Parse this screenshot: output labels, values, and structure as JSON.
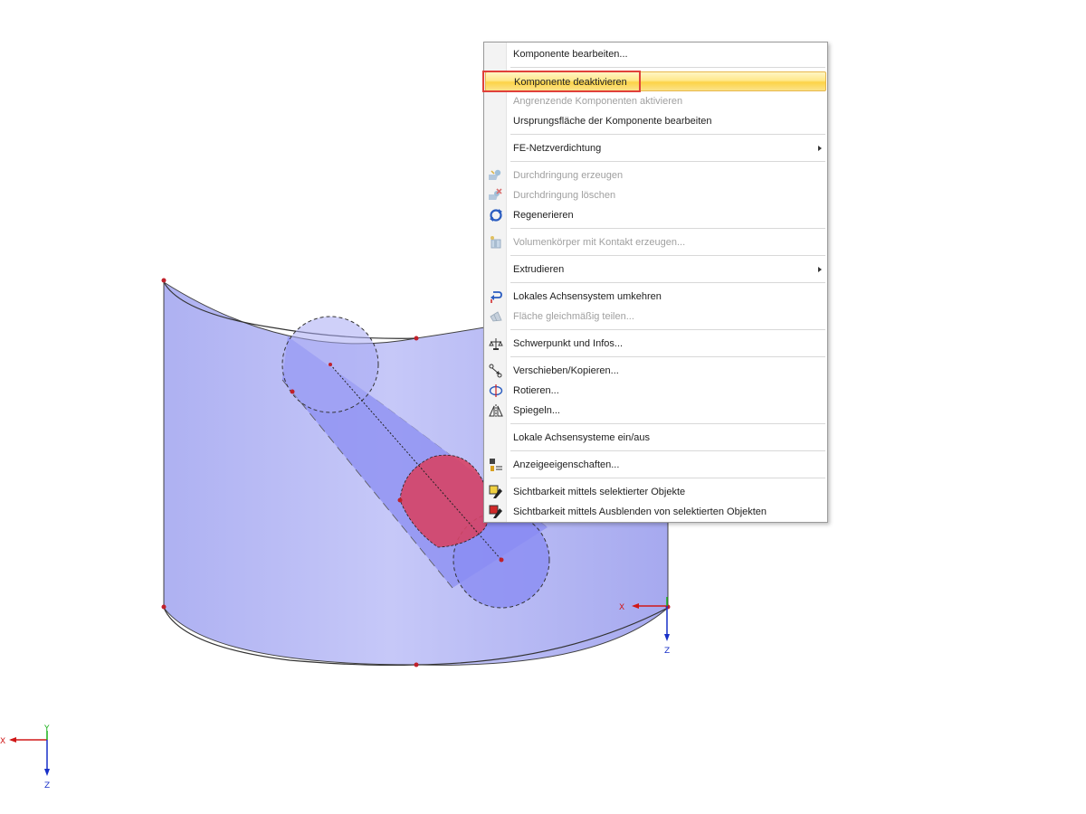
{
  "scene": {
    "origin_axis": {
      "x_label": "X",
      "y_label": "Y",
      "z_label": "Z"
    },
    "local_axis": {
      "x_label": "X",
      "y_label": "Y",
      "z_label": "Z"
    },
    "colors": {
      "shell_fill": "#b9bcf6",
      "cylinder_fill": "#8a8cf2",
      "intersection_fill": "#d64466",
      "node": "#c0202a",
      "x_axis": "#d01818",
      "y_axis": "#18b018",
      "z_axis": "#1830c8"
    }
  },
  "context_menu": {
    "items": [
      {
        "label": "Komponente bearbeiten...",
        "icon": "",
        "enabled": true
      },
      {
        "label": "Komponente deaktivieren",
        "icon": "",
        "enabled": true,
        "highlighted": true
      },
      {
        "label": "Angrenzende Komponenten aktivieren",
        "icon": "",
        "enabled": false
      },
      {
        "label": "Ursprungsfläche der Komponente bearbeiten",
        "icon": "",
        "enabled": true
      },
      {
        "label": "FE-Netzverdichtung",
        "icon": "",
        "enabled": true,
        "submenu": true
      },
      {
        "label": "Durchdringung erzeugen",
        "icon": "intersection-create-icon",
        "enabled": false
      },
      {
        "label": "Durchdringung löschen",
        "icon": "intersection-delete-icon",
        "enabled": false
      },
      {
        "label": "Regenerieren",
        "icon": "regenerate-icon",
        "enabled": true
      },
      {
        "label": "Volumenkörper mit Kontakt erzeugen...",
        "icon": "solid-contact-icon",
        "enabled": false
      },
      {
        "label": "Extrudieren",
        "icon": "",
        "enabled": true,
        "submenu": true
      },
      {
        "label": "Lokales Achsensystem umkehren",
        "icon": "reverse-axes-icon",
        "enabled": true
      },
      {
        "label": "Fläche gleichmäßig teilen...",
        "icon": "divide-surface-icon",
        "enabled": false
      },
      {
        "label": "Schwerpunkt und Infos...",
        "icon": "center-of-gravity-icon",
        "enabled": true
      },
      {
        "label": "Verschieben/Kopieren...",
        "icon": "move-copy-icon",
        "enabled": true
      },
      {
        "label": "Rotieren...",
        "icon": "rotate-icon",
        "enabled": true
      },
      {
        "label": "Spiegeln...",
        "icon": "mirror-icon",
        "enabled": true
      },
      {
        "label": "Lokale Achsensysteme ein/aus",
        "icon": "",
        "enabled": true
      },
      {
        "label": "Anzeigeeigenschaften...",
        "icon": "display-properties-icon",
        "enabled": true
      },
      {
        "label": "Sichtbarkeit mittels selektierter Objekte",
        "icon": "visibility-selected-icon",
        "enabled": true
      },
      {
        "label": "Sichtbarkeit mittels Ausblenden von selektierten Objekten",
        "icon": "visibility-hide-selected-icon",
        "enabled": true
      }
    ]
  }
}
